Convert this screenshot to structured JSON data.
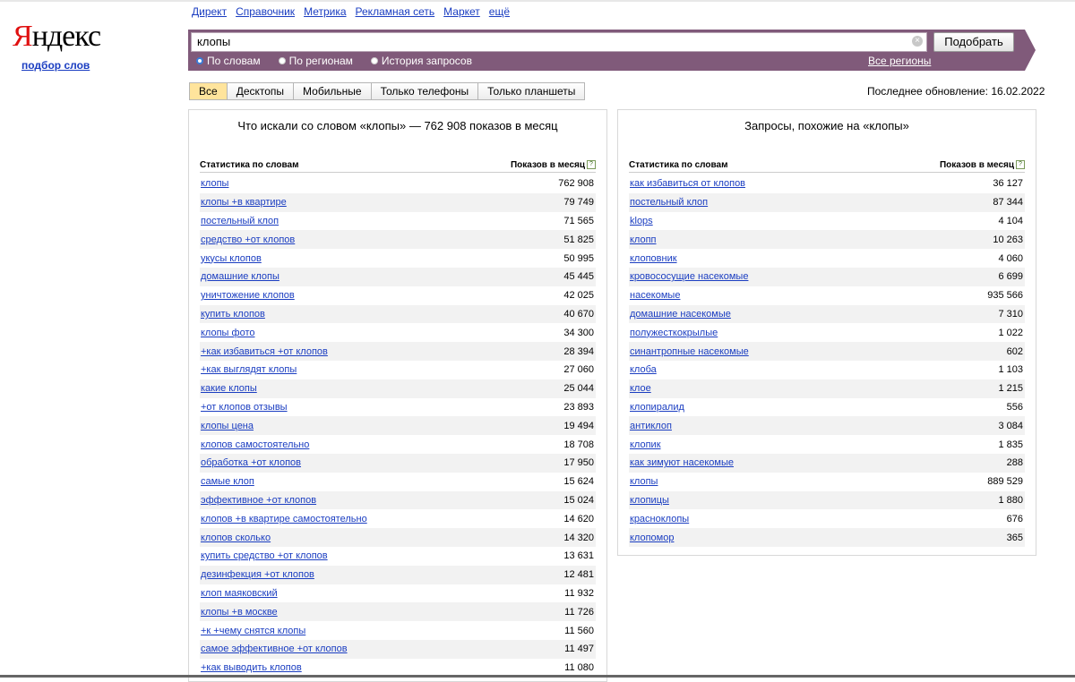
{
  "header": {
    "links": [
      "Директ",
      "Справочник",
      "Метрика",
      "Рекламная сеть",
      "Маркет",
      "ещё"
    ],
    "logo_red": "Я",
    "logo_rest": "ндекс",
    "sublogo": "подбор слов"
  },
  "search": {
    "value": "клопы",
    "button": "Подобрать",
    "radios": [
      {
        "label": "По словам",
        "checked": true
      },
      {
        "label": "По регионам",
        "checked": false
      },
      {
        "label": "История запросов",
        "checked": false
      }
    ],
    "regions_link": "Все регионы",
    "band_color": "#805a7a"
  },
  "tabs": [
    "Все",
    "Десктопы",
    "Мобильные",
    "Только телефоны",
    "Только планшеты"
  ],
  "active_tab": "Все",
  "updated": "Последнее обновление: 16.02.2022",
  "left_panel": {
    "title": "Что искали со словом «клопы» — 762 908 показов в месяц",
    "col_words": "Статистика по словам",
    "col_count": "Показов в месяц",
    "rows": [
      [
        "клопы",
        "762 908"
      ],
      [
        "клопы +в квартире",
        "79 749"
      ],
      [
        "постельный клоп",
        "71 565"
      ],
      [
        "средство +от клопов",
        "51 825"
      ],
      [
        "укусы клопов",
        "50 995"
      ],
      [
        "домашние клопы",
        "45 445"
      ],
      [
        "уничтожение клопов",
        "42 025"
      ],
      [
        "купить клопов",
        "40 670"
      ],
      [
        "клопы фото",
        "34 300"
      ],
      [
        "+как избавиться +от клопов",
        "28 394"
      ],
      [
        "+как выглядят клопы",
        "27 060"
      ],
      [
        "какие клопы",
        "25 044"
      ],
      [
        "+от клопов отзывы",
        "23 893"
      ],
      [
        "клопы цена",
        "19 494"
      ],
      [
        "клопов самостоятельно",
        "18 708"
      ],
      [
        "обработка +от клопов",
        "17 950"
      ],
      [
        "самые клоп",
        "15 624"
      ],
      [
        "эффективное +от клопов",
        "15 024"
      ],
      [
        "клопов +в квартире самостоятельно",
        "14 620"
      ],
      [
        "клопов сколько",
        "14 320"
      ],
      [
        "купить средство +от клопов",
        "13 631"
      ],
      [
        "дезинфекция +от клопов",
        "12 481"
      ],
      [
        "клоп маяковский",
        "11 932"
      ],
      [
        "клопы +в москве",
        "11 726"
      ],
      [
        "+к +чему снятся клопы",
        "11 560"
      ],
      [
        "самое эффективное +от клопов",
        "11 497"
      ],
      [
        "+как выводить клопов",
        "11 080"
      ]
    ]
  },
  "right_panel": {
    "title": "Запросы, похожие на «клопы»",
    "col_words": "Статистика по словам",
    "col_count": "Показов в месяц",
    "rows": [
      [
        "как избавиться от клопов",
        "36 127"
      ],
      [
        "постельный клоп",
        "87 344"
      ],
      [
        "klops",
        "4 104"
      ],
      [
        "клопп",
        "10 263"
      ],
      [
        "клоповник",
        "4 060"
      ],
      [
        "кровососущие насекомые",
        "6 699"
      ],
      [
        "насекомые",
        "935 566"
      ],
      [
        "домашние насекомые",
        "7 310"
      ],
      [
        "полужесткокрылые",
        "1 022"
      ],
      [
        "синантропные насекомые",
        "602"
      ],
      [
        "клоба",
        "1 103"
      ],
      [
        "клое",
        "1 215"
      ],
      [
        "клопиралид",
        "556"
      ],
      [
        "антиклоп",
        "3 084"
      ],
      [
        "клопик",
        "1 835"
      ],
      [
        "как зимуют насекомые",
        "288"
      ],
      [
        "клопы",
        "889 529"
      ],
      [
        "клопицы",
        "1 880"
      ],
      [
        "красноклопы",
        "676"
      ],
      [
        "клопомор",
        "365"
      ]
    ]
  },
  "help_icon": "?"
}
